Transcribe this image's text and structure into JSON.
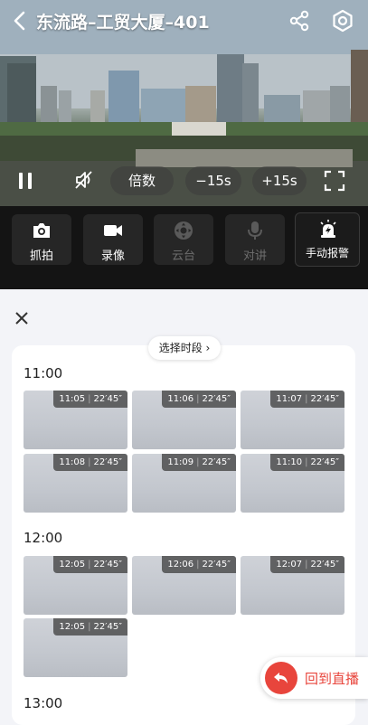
{
  "header": {
    "title": "东流路–工贸大厦–401"
  },
  "player": {
    "speed_label": "倍数",
    "rewind_label": "−15s",
    "forward_label": "+15s"
  },
  "toolbar": {
    "items": [
      {
        "label": "抓拍",
        "icon": "camera-icon",
        "enabled": true
      },
      {
        "label": "录像",
        "icon": "video-camera-icon",
        "enabled": true
      },
      {
        "label": "云台",
        "icon": "ptz-icon",
        "enabled": false
      },
      {
        "label": "对讲",
        "icon": "microphone-icon",
        "enabled": false
      },
      {
        "label": "手动报警",
        "icon": "alarm-icon",
        "enabled": true
      }
    ]
  },
  "panel": {
    "period_button": "选择时段 ›",
    "groups": [
      {
        "hour": "11:00",
        "clips": [
          {
            "time": "11:05",
            "duration": "22′45″"
          },
          {
            "time": "11:06",
            "duration": "22′45″"
          },
          {
            "time": "11:07",
            "duration": "22′45″"
          },
          {
            "time": "11:08",
            "duration": "22′45″"
          },
          {
            "time": "11:09",
            "duration": "22′45″"
          },
          {
            "time": "11:10",
            "duration": "22′45″"
          }
        ]
      },
      {
        "hour": "12:00",
        "clips": [
          {
            "time": "12:05",
            "duration": "22′45″"
          },
          {
            "time": "12:06",
            "duration": "22′45″"
          },
          {
            "time": "12:07",
            "duration": "22′45″"
          },
          {
            "time": "12:05",
            "duration": "22′45″"
          }
        ]
      },
      {
        "hour": "13:00",
        "clips": []
      }
    ]
  },
  "live_button": {
    "label": "回到直播"
  },
  "colors": {
    "accent": "#e8453c",
    "toolbar_bg": "#141414",
    "panel_bg": "#f3f4f8"
  }
}
